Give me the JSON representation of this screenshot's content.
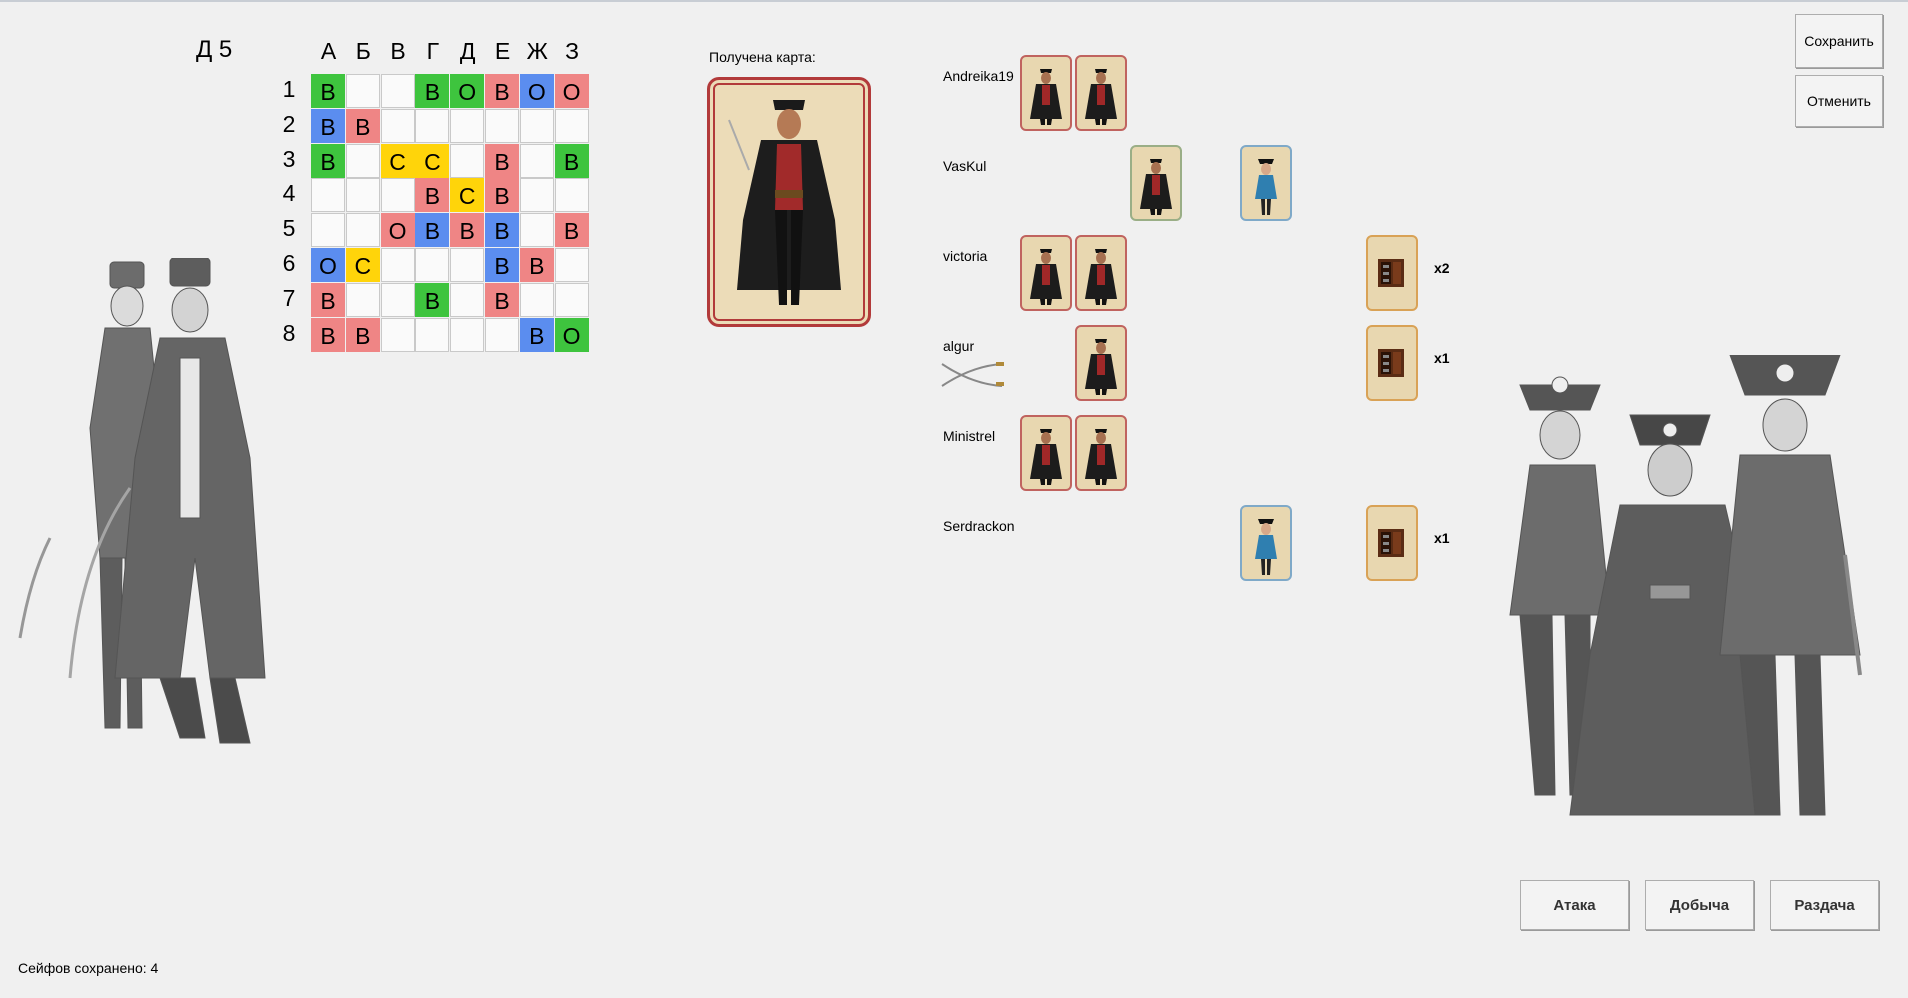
{
  "coord": "Д 5",
  "board": {
    "columns": [
      "А",
      "Б",
      "В",
      "Г",
      "Д",
      "Е",
      "Ж",
      "З"
    ],
    "rows": [
      "1",
      "2",
      "3",
      "4",
      "5",
      "6",
      "7",
      "8"
    ],
    "cells": [
      [
        {
          "t": "В",
          "c": "B"
        },
        {
          "t": "",
          "c": ""
        },
        {
          "t": "",
          "c": ""
        },
        {
          "t": "В",
          "c": "B"
        },
        {
          "t": "О",
          "c": "B"
        },
        {
          "t": "В",
          "c": "R"
        },
        {
          "t": "О",
          "c": "Bl"
        },
        {
          "t": "О",
          "c": "R"
        }
      ],
      [
        {
          "t": "В",
          "c": "Bl"
        },
        {
          "t": "В",
          "c": "R"
        },
        {
          "t": "",
          "c": ""
        },
        {
          "t": "",
          "c": ""
        },
        {
          "t": "",
          "c": ""
        },
        {
          "t": "",
          "c": ""
        },
        {
          "t": "",
          "c": ""
        },
        {
          "t": "",
          "c": ""
        }
      ],
      [
        {
          "t": "В",
          "c": "B"
        },
        {
          "t": "",
          "c": ""
        },
        {
          "t": "С",
          "c": "Y"
        },
        {
          "t": "С",
          "c": "Y"
        },
        {
          "t": "",
          "c": ""
        },
        {
          "t": "В",
          "c": "R"
        },
        {
          "t": "",
          "c": ""
        },
        {
          "t": "В",
          "c": "B"
        }
      ],
      [
        {
          "t": "",
          "c": ""
        },
        {
          "t": "",
          "c": ""
        },
        {
          "t": "",
          "c": ""
        },
        {
          "t": "В",
          "c": "R"
        },
        {
          "t": "С",
          "c": "Y"
        },
        {
          "t": "В",
          "c": "R"
        },
        {
          "t": "",
          "c": ""
        },
        {
          "t": "",
          "c": ""
        }
      ],
      [
        {
          "t": "",
          "c": ""
        },
        {
          "t": "",
          "c": ""
        },
        {
          "t": "О",
          "c": "R"
        },
        {
          "t": "В",
          "c": "Bl"
        },
        {
          "t": "В",
          "c": "R"
        },
        {
          "t": "В",
          "c": "Bl"
        },
        {
          "t": "",
          "c": ""
        },
        {
          "t": "В",
          "c": "R"
        }
      ],
      [
        {
          "t": "О",
          "c": "Bl"
        },
        {
          "t": "С",
          "c": "Y"
        },
        {
          "t": "",
          "c": ""
        },
        {
          "t": "",
          "c": ""
        },
        {
          "t": "",
          "c": ""
        },
        {
          "t": "В",
          "c": "Bl"
        },
        {
          "t": "В",
          "c": "R"
        },
        {
          "t": "",
          "c": ""
        }
      ],
      [
        {
          "t": "В",
          "c": "R"
        },
        {
          "t": "",
          "c": ""
        },
        {
          "t": "",
          "c": ""
        },
        {
          "t": "В",
          "c": "B"
        },
        {
          "t": "",
          "c": ""
        },
        {
          "t": "В",
          "c": "R"
        },
        {
          "t": "",
          "c": ""
        },
        {
          "t": "",
          "c": ""
        }
      ],
      [
        {
          "t": "В",
          "c": "R"
        },
        {
          "t": "В",
          "c": "R"
        },
        {
          "t": "",
          "c": ""
        },
        {
          "t": "",
          "c": ""
        },
        {
          "t": "",
          "c": ""
        },
        {
          "t": "",
          "c": ""
        },
        {
          "t": "В",
          "c": "Bl"
        },
        {
          "t": "О",
          "c": "B"
        }
      ]
    ]
  },
  "received_card_label": "Получена карта:",
  "players": [
    {
      "name": "Andreika19"
    },
    {
      "name": "VasKul"
    },
    {
      "name": "victoria",
      "safes": "x2"
    },
    {
      "name": "algur",
      "safes": "x1"
    },
    {
      "name": "Ministrel"
    },
    {
      "name": "Serdrackon",
      "safes": "x1"
    }
  ],
  "buttons": {
    "save": "Сохранить",
    "cancel": "Отменить",
    "attack": "Атака",
    "loot": "Добыча",
    "deal": "Раздача"
  },
  "status": "Сейфов сохранено: 4",
  "icons": {
    "pirate_card": "pirate-man-card-icon",
    "lady_card": "pirate-lady-card-icon",
    "safe_card": "safe-card-icon",
    "crossed_sabers": "crossed-sabers-icon"
  },
  "colors": {
    "green": "#3ec43e",
    "blue": "#5b8def",
    "red": "#ef8585",
    "yellow": "#ffd40a"
  }
}
